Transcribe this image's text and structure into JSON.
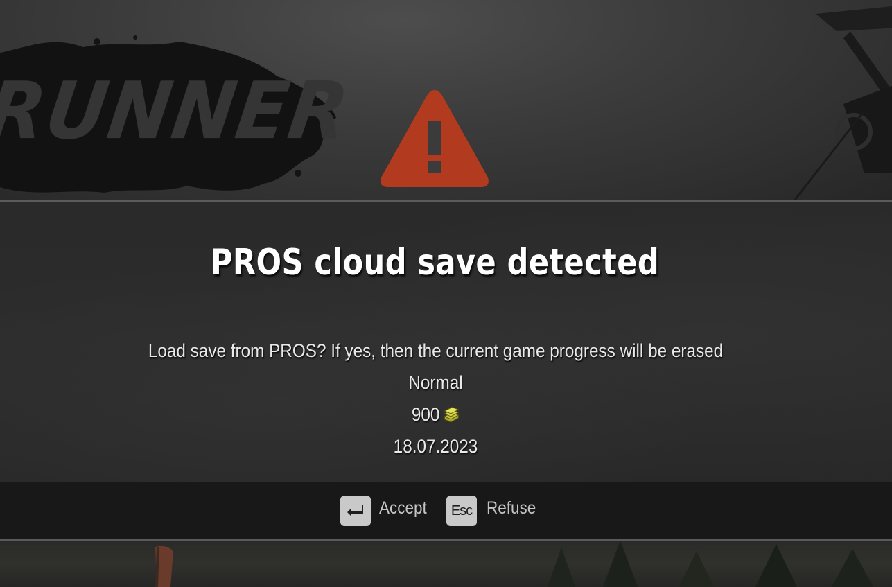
{
  "logo": {
    "text": "RUNNER"
  },
  "dialog": {
    "title": "PROS cloud save detected",
    "message": "Load save from PROS? If yes, then the current game progress will be erased",
    "difficulty": "Normal",
    "money": "900",
    "money_icon": "money-stack-icon",
    "date": "18.07.2023",
    "warning_icon": "warning-triangle-icon",
    "warning_color": "#b23a1f"
  },
  "actions": {
    "accept_key_icon": "enter-key-icon",
    "accept_label": "Accept",
    "refuse_key": "Esc",
    "refuse_label": "Refuse"
  }
}
